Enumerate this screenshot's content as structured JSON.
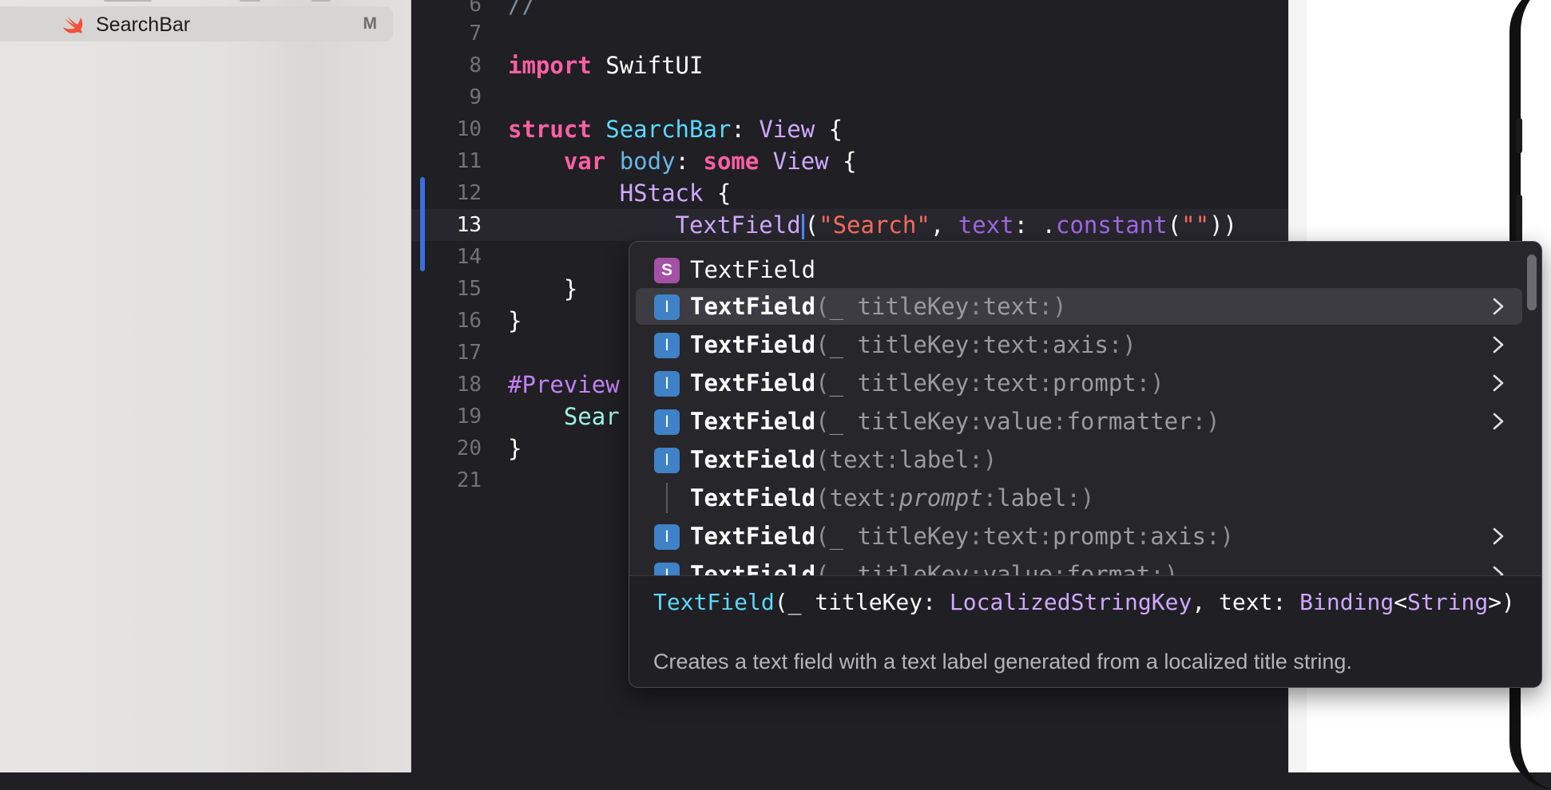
{
  "sidebar": {
    "file_name": "SearchBar",
    "file_badge": "M",
    "file_icon": "swift-file-icon"
  },
  "editor": {
    "line_numbers": [
      "6",
      "7",
      "8",
      "9",
      "10",
      "11",
      "12",
      "13",
      "14",
      "15",
      "16",
      "17",
      "18",
      "19",
      "20",
      "21"
    ],
    "current_line": "13",
    "code": {
      "l6": "//",
      "l8_kw": "import",
      "l8_mod": "SwiftUI",
      "l10_kw": "struct",
      "l10_name": "SearchBar",
      "l10_colon": ":",
      "l10_type": "View",
      "l10_brace": "{",
      "l11_kw": "var",
      "l11_name": "body",
      "l11_colon": ":",
      "l11_some": "some",
      "l11_type": "View",
      "l11_brace": "{",
      "l12_type": "HStack",
      "l12_brace": "{",
      "l13_name": "TextField",
      "l13_open": "(",
      "l13_str": "\"Search\"",
      "l13_comma": ",",
      "l13_arg": "text",
      "l13_colon": ":",
      "l13_dot": ".",
      "l13_fn": "constant",
      "l13_open2": "(",
      "l13_str2": "\"\"",
      "l13_close": "))",
      "l15": "}",
      "l16": "}",
      "l18": "#Preview",
      "l19": "Sear",
      "l20": "}"
    }
  },
  "completion": {
    "items": [
      {
        "badge": "S",
        "name": "TextField",
        "args": "",
        "chevron": false
      },
      {
        "badge": "I",
        "name": "TextField",
        "args_html": [
          "(_ ",
          "titleKey",
          ":",
          "text",
          ":)"
        ],
        "chevron": true
      },
      {
        "badge": "I",
        "name": "TextField",
        "args_html": [
          "(_ ",
          "titleKey",
          ":",
          "text",
          ":",
          "axis",
          ":)"
        ],
        "chevron": true
      },
      {
        "badge": "I",
        "name": "TextField",
        "args_html": [
          "(_ ",
          "titleKey",
          ":",
          "text",
          ":",
          "prompt",
          ":)"
        ],
        "chevron": true
      },
      {
        "badge": "I",
        "name": "TextField",
        "args_html": [
          "(_ ",
          "titleKey",
          ":",
          "value",
          ":",
          "formatter",
          ":)"
        ],
        "chevron": true
      },
      {
        "badge": "I",
        "name": "TextField",
        "args_html": [
          "(",
          "text",
          ":",
          "label",
          ":)"
        ],
        "chevron": false
      },
      {
        "badge": "",
        "name": "TextField",
        "args_html": [
          "(",
          "text",
          ":",
          "prompt",
          ":",
          "label",
          ":)"
        ],
        "chevron": false
      },
      {
        "badge": "I",
        "name": "TextField",
        "args_html": [
          "(_ ",
          "titleKey",
          ":",
          "text",
          ":",
          "prompt",
          ":",
          "axis",
          ":)"
        ],
        "chevron": true
      },
      {
        "badge": "I",
        "name": "TextField",
        "args_html": [
          "(_ ",
          "titleKey",
          ":",
          "value",
          ":",
          "format",
          ":)"
        ],
        "chevron": true
      }
    ],
    "selected_index": 1,
    "doc": {
      "sig_fn": "TextField",
      "sig_open": "(_ titleKey: ",
      "sig_t1": "LocalizedStringKey",
      "sig_mid": ", text: ",
      "sig_t2": "Binding",
      "sig_lt": "<",
      "sig_t3": "String",
      "sig_end": ">)",
      "description": "Creates a text field with a text label generated from a localized title string."
    }
  },
  "colors": {
    "keyword": "#fc5fa3",
    "type": "#d0a8ff",
    "declaration": "#5dd8ff",
    "string": "#fc6a5d",
    "editor_bg": "#1f1f24"
  }
}
